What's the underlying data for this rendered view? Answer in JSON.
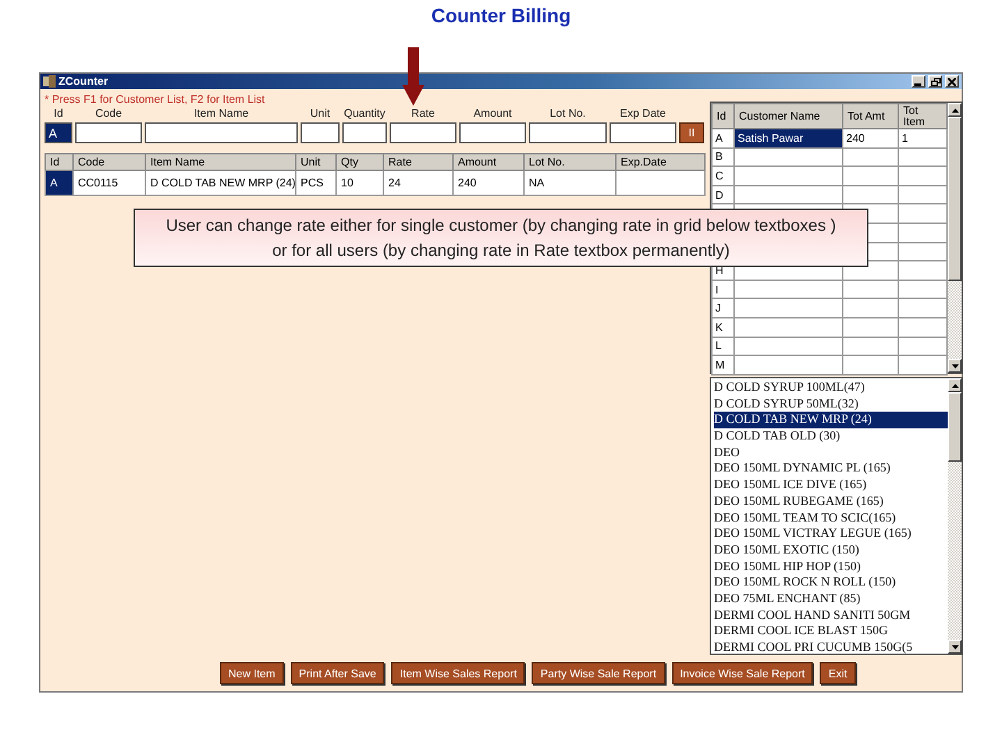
{
  "slide_title": "Counter Billing",
  "window": {
    "title": "ZCounter"
  },
  "hint": "* Press F1 for Customer List, F2 for Item List",
  "entry_fields": [
    {
      "label": "Id",
      "value": "A",
      "highlighted": true
    },
    {
      "label": "Code",
      "highlighted": false
    },
    {
      "label": "Item Name",
      "highlighted": false
    },
    {
      "label": "Unit",
      "highlighted": false
    },
    {
      "label": "Quantity",
      "highlighted": false
    },
    {
      "label": "Rate",
      "highlighted": false
    },
    {
      "label": "Amount",
      "highlighted": false
    },
    {
      "label": "Lot No.",
      "highlighted": false
    },
    {
      "label": "Exp Date",
      "highlighted": false
    }
  ],
  "entry_button": "II",
  "item_grid": {
    "columns": [
      "Id",
      "Code",
      "Item Name",
      "Unit",
      "Qty",
      "Rate",
      "Amount",
      "Lot No.",
      "Exp.Date"
    ],
    "rows": [
      {
        "selected": true,
        "cells": [
          "A",
          "CC0115",
          "D COLD TAB NEW MRP (24)",
          "PCS",
          "10",
          "24",
          "240",
          "NA"
        ]
      }
    ]
  },
  "customer_grid": {
    "columns": [
      "Id",
      "Customer Name",
      "Tot Amt",
      "Tot Item"
    ],
    "rows": [
      {
        "id": "A",
        "name": "Satish Pawar",
        "tot_amt": "240",
        "tot_item": "1",
        "selected": true
      },
      {
        "id": "B",
        "selected": false
      },
      {
        "id": "C",
        "selected": false
      },
      {
        "id": "D",
        "selected": false
      },
      {
        "selected": false
      },
      {},
      {},
      {
        "id": "H",
        "selected": false
      },
      {
        "id": "I",
        "selected": false
      },
      {
        "id": "J",
        "selected": false
      },
      {
        "id": "K",
        "selected": false
      },
      {
        "id": "L",
        "selected": false
      },
      {
        "id": "M",
        "selected": false
      }
    ]
  },
  "item_list": [
    {
      "label": "D COLD SYRUP 100ML(47)",
      "selected": false
    },
    {
      "label": "D COLD SYRUP 50ML(32)",
      "selected": false
    },
    {
      "label": "D COLD TAB NEW MRP (24)",
      "selected": true
    },
    {
      "label": "D COLD TAB OLD (30)",
      "selected": false
    },
    {
      "label": "DEO",
      "selected": false
    },
    {
      "label": "DEO 150ML DYNAMIC PL (165)",
      "selected": false
    },
    {
      "label": "DEO 150ML ICE DIVE (165)",
      "selected": false
    },
    {
      "label": "DEO 150ML RUBEGAME (165)",
      "selected": false
    },
    {
      "label": "DEO 150ML TEAM TO SCIC(165)",
      "selected": false
    },
    {
      "label": "DEO 150ML VICTRAY LEGUE (165)",
      "selected": false
    },
    {
      "label": "DEO 150ML EXOTIC (150)",
      "selected": false
    },
    {
      "label": "DEO 150ML HIP HOP (150)",
      "selected": false
    },
    {
      "label": "DEO 150ML ROCK N ROLL (150)",
      "selected": false
    },
    {
      "label": "DEO 75ML ENCHANT (85)",
      "selected": false
    },
    {
      "label": "DERMI COOL HAND SANITI 50GM",
      "selected": false
    },
    {
      "label": "DERMI COOL ICE BLAST 150G",
      "selected": false
    },
    {
      "label": "DERMI COOL PRI CUCUMB 150G(5",
      "selected": false
    }
  ],
  "buttons": [
    "New Item",
    "Print After Save",
    "Item Wise Sales Report",
    "Party Wise Sale Report",
    "Invoice Wise Sale Report",
    "Exit"
  ],
  "note": "User can change rate either for single customer (by changing rate in grid below textboxes ) or for all users (by changing rate in Rate textbox permanently)"
}
